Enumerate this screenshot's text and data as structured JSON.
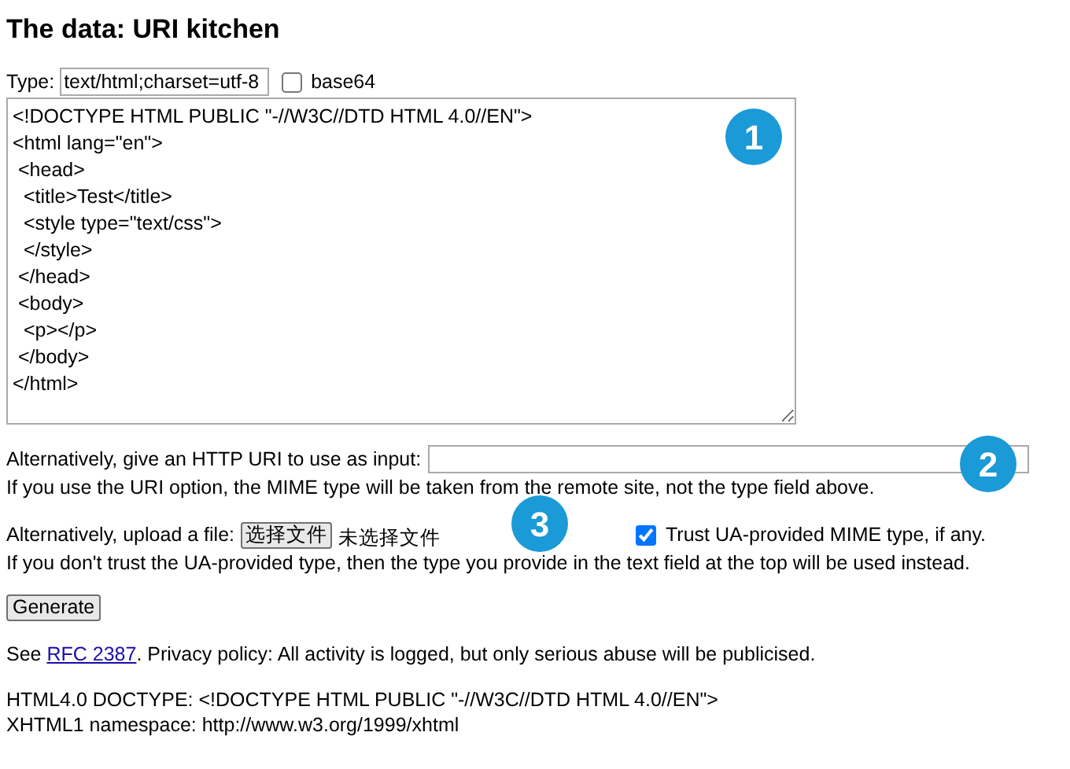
{
  "heading": "The data: URI kitchen",
  "type_field": {
    "label": "Type:",
    "value": "text/html;charset=utf-8"
  },
  "base64": {
    "label": "base64",
    "checked": false
  },
  "source": "<!DOCTYPE HTML PUBLIC \"-//W3C//DTD HTML 4.0//EN\">\n<html lang=\"en\">\n <head>\n  <title>Test</title>\n  <style type=\"text/css\">\n  </style>\n </head>\n <body>\n  <p></p>\n </body>\n</html>",
  "uri": {
    "label": "Alternatively, give an HTTP URI to use as input:",
    "note": "If you use the URI option, the MIME type will be taken from the remote site, not the type field above."
  },
  "upload": {
    "label": "Alternatively, upload a file:",
    "button": "选择文件",
    "status": "未选择文件",
    "note": "If you don't trust the UA-provided type, then the type you provide in the text field at the top will be used instead."
  },
  "trust": {
    "label": "Trust UA-provided MIME type, if any.",
    "checked": true
  },
  "generate_button": "Generate",
  "footer": {
    "prefix": "See ",
    "link": "RFC 2387",
    "suffix": ". Privacy policy: All activity is logged, but only serious abuse will be publicised."
  },
  "info": [
    "HTML4.0 DOCTYPE: <!DOCTYPE HTML PUBLIC \"-//W3C//DTD HTML 4.0//EN\">",
    "XHTML1 namespace: http://www.w3.org/1999/xhtml"
  ],
  "callouts": [
    "1",
    "2",
    "3"
  ]
}
